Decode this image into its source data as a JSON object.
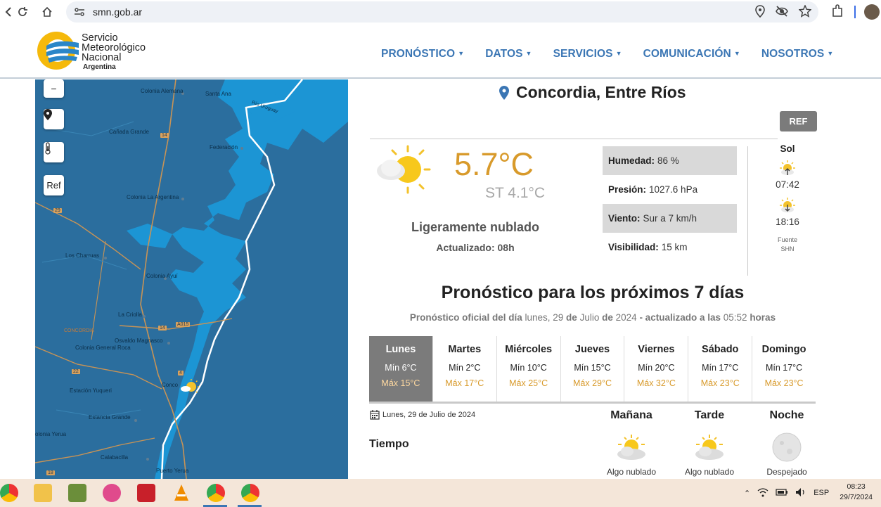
{
  "browser": {
    "url": "smn.gob.ar"
  },
  "site": {
    "logo_line1": "Servicio",
    "logo_line2": "Meteorológico",
    "logo_line3": "Nacional",
    "logo_line4": "Argentina",
    "nav": [
      "PRONÓSTICO",
      "DATOS",
      "SERVICIOS",
      "COMUNICACIÓN",
      "NOSOTROS"
    ]
  },
  "map": {
    "zoom_out_label": "−",
    "ref_label": "Ref",
    "labels": {
      "colonia_alemana": "Colonia Alemana",
      "santa_ana": "Santa Ana",
      "rio_uruguay": "Río Uruguay",
      "canada_grande": "Cañada Grande",
      "federacion": "Federación",
      "colonia_la_argentina": "Colonia La Argentina",
      "los_charruas": "Los Charruas",
      "colonia_ayui": "Colonia Ayuí",
      "la_criolla": "La Criolla",
      "concordia_dept": "CONCORDIA",
      "osvaldo_magnasco": "Osvaldo Magnasco",
      "colonia_general_roca": "Colonia General Roca",
      "estacion_yuqueri": "Estación Yuqueri",
      "concordia": "Conco",
      "estancia_grande": "Estancia Grande",
      "colonia_yerua": "olonia Yerua",
      "calabacilla": "Calabacilla",
      "puerto_yerua": "Puerto Yerua",
      "road_a015": "A015",
      "road_14a": "14",
      "road_14b": "14",
      "road_29": "29",
      "road_22": "22",
      "road_18": "18",
      "road_4": "4"
    }
  },
  "weather": {
    "city": "Concordia, Entre Ríos",
    "ref_button": "REF",
    "temperature": "5.7°C",
    "feels_like": "ST 4.1°C",
    "description": "Ligeramente nublado",
    "updated": "Actualizado: 08h",
    "humidity_label": "Humedad:",
    "humidity_value": "86 %",
    "pressure_label": "Presión:",
    "pressure_value": "1027.6 hPa",
    "wind_label": "Viento:",
    "wind_value": "Sur a 7 km/h",
    "visibility_label": "Visibilidad:",
    "visibility_value": "15 km",
    "sun_title": "Sol",
    "sunrise": "07:42",
    "sunset": "18:16",
    "sun_source_1": "Fuente",
    "sun_source_2": "SHN"
  },
  "forecast": {
    "title": "Pronóstico para los próximos 7 días",
    "sub_a": "Pronóstico oficial del día",
    "sub_b": "lunes, 29",
    "sub_c": "de",
    "sub_d": "Julio",
    "sub_e": "de",
    "sub_f": "2024",
    "sub_g": "- actualizado a las",
    "sub_h": "05:52",
    "sub_i": "horas",
    "days": [
      {
        "name": "Lunes",
        "min": "Mín 6°C",
        "max": "Máx 15°C"
      },
      {
        "name": "Martes",
        "min": "Mín 2°C",
        "max": "Máx 17°C"
      },
      {
        "name": "Miércoles",
        "min": "Mín 10°C",
        "max": "Máx 25°C"
      },
      {
        "name": "Jueves",
        "min": "Mín 15°C",
        "max": "Máx 29°C"
      },
      {
        "name": "Viernes",
        "min": "Mín 20°C",
        "max": "Máx 32°C"
      },
      {
        "name": "Sábado",
        "min": "Mín 17°C",
        "max": "Máx 23°C"
      },
      {
        "name": "Domingo",
        "min": "Mín 17°C",
        "max": "Máx 23°C"
      }
    ],
    "date_label": "Lunes, 29 de Julio de 2024",
    "tiempo_label": "Tiempo",
    "periods": [
      {
        "name": "Mañana",
        "desc": "Algo nublado"
      },
      {
        "name": "Tarde",
        "desc": "Algo nublado"
      },
      {
        "name": "Noche",
        "desc": "Despejado"
      }
    ]
  },
  "taskbar": {
    "lang": "ESP",
    "time": "08:23",
    "date": "29/7/2024"
  },
  "colors": {
    "nav": "#3b76b4",
    "temp": "#d89a2b",
    "map_land": "#2b6e9e",
    "map_water": "#1c95d4",
    "active_day": "#7b7b7b"
  }
}
